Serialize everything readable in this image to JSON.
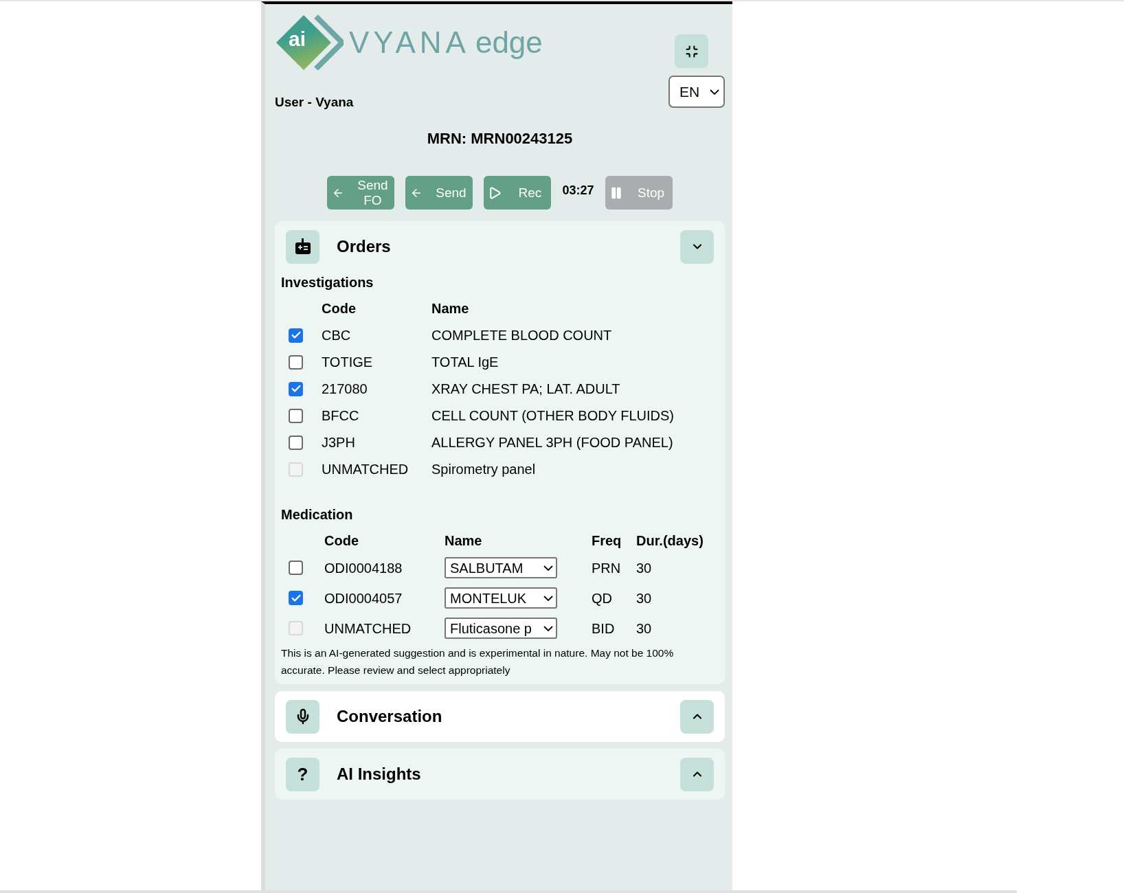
{
  "logo": {
    "badge": "ai",
    "wordmark": "VYANA",
    "suffix": "edge"
  },
  "language": {
    "value": "EN"
  },
  "user": "User - Vyana",
  "mrn": "MRN: MRN00243125",
  "controls": [
    {
      "kind": "send",
      "label": "Send FO",
      "disabled": false
    },
    {
      "kind": "send",
      "label": "Send",
      "disabled": false
    },
    {
      "kind": "rec",
      "label": "Rec",
      "disabled": false
    },
    {
      "kind": "timer",
      "label": "03:27"
    },
    {
      "kind": "stop",
      "label": "Stop",
      "disabled": true
    }
  ],
  "sections": [
    {
      "kind": "orders",
      "title": "Orders",
      "expanded": true,
      "highlighted": false
    },
    {
      "kind": "conversation",
      "title": "Conversation",
      "expanded": false,
      "highlighted": true
    },
    {
      "kind": "insights",
      "title": "AI Insights",
      "glyph": "?",
      "expanded": false,
      "highlighted": false
    }
  ],
  "investigations": {
    "title": "Investigations",
    "columns": [
      "Code",
      "Name"
    ],
    "rows": [
      {
        "code": "CBC",
        "name": "COMPLETE BLOOD COUNT",
        "checked": true,
        "disabled": false
      },
      {
        "code": "TOTIGE",
        "name": "TOTAL IgE",
        "checked": false,
        "disabled": false
      },
      {
        "code": "217080",
        "name": "XRAY CHEST PA; LAT. ADULT",
        "checked": true,
        "disabled": false
      },
      {
        "code": "BFCC",
        "name": "CELL COUNT (OTHER BODY FLUIDS)",
        "checked": false,
        "disabled": false
      },
      {
        "code": "J3PH",
        "name": "ALLERGY PANEL 3PH (FOOD PANEL)",
        "checked": false,
        "disabled": false
      },
      {
        "code": "UNMATCHED",
        "name": "Spirometry panel",
        "checked": false,
        "disabled": true
      }
    ]
  },
  "medication": {
    "title": "Medication",
    "columns": [
      "Code",
      "Name",
      "Freq",
      "Dur.(days)"
    ],
    "rows": [
      {
        "code": "ODI0004188",
        "name": "SALBUTAM",
        "freq": "PRN",
        "duration": "30",
        "checked": false,
        "disabled": false
      },
      {
        "code": "ODI0004057",
        "name": "MONTELUK",
        "freq": "QD",
        "duration": "30",
        "checked": true,
        "disabled": false
      },
      {
        "code": "UNMATCHED",
        "name": "Fluticasone p",
        "freq": "BID",
        "duration": "30",
        "checked": false,
        "disabled": true
      }
    ]
  },
  "disclaimer": "This is an AI-generated suggestion and is experimental in nature. May not be 100% accurate. Please review and select appropriately"
}
